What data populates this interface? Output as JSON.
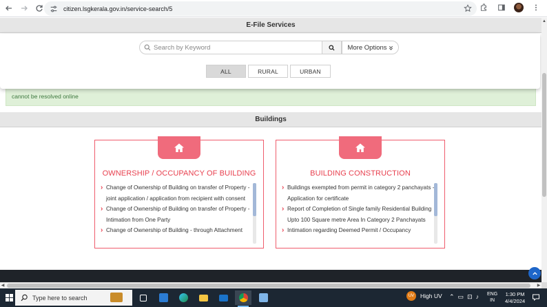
{
  "browser": {
    "url": "citizen.lsgkerala.gov.in/service-search/5"
  },
  "page": {
    "efile_title": "E-File Services",
    "search": {
      "placeholder": "Search by Keyword",
      "more_options_label": "More Options"
    },
    "filters": [
      {
        "label": "ALL",
        "selected": true
      },
      {
        "label": "RURAL",
        "selected": false
      },
      {
        "label": "URBAN",
        "selected": false
      }
    ],
    "notice_text": "cannot be resolved online",
    "buildings_title": "Buildings",
    "cards": [
      {
        "title": "OWNERSHIP / OCCUPANCY OF BUILDING",
        "items": [
          "Change of Ownership of Building on transfer of Property - joint application / application from recipient with consent",
          "Change of Ownership of Building on transfer of Property - Intimation from One Party",
          "Change of Ownership of Building - through Attachment"
        ]
      },
      {
        "title": "BUILDING CONSTRUCTION",
        "items": [
          "Buildings exempted from permit in category 2 panchayats - Application for certificate",
          "Report of Completion of Single family Residential Building Upto 100 Square metre Area In Category 2 Panchayats",
          "Intimation regarding Deemed Permit / Occupancy"
        ]
      }
    ]
  },
  "taskbar": {
    "search_text": "Type here to search",
    "weather": "High UV",
    "lang_line1": "ENG",
    "lang_line2": "IN",
    "time": "1:30 PM",
    "date": "4/4/2024"
  },
  "colors": {
    "accent_red": "#e8404f",
    "badge_pink": "#f06b7c",
    "notice_green": "#dff0d8",
    "taskbar": "#1c2733"
  }
}
